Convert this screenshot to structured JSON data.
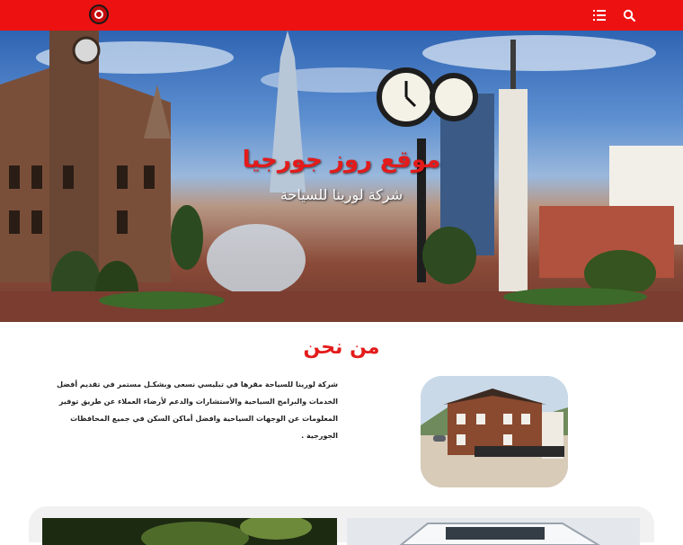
{
  "header": {
    "logo_icon": "rose-logo-icon",
    "menu_icon": "menu-list-icon",
    "search_icon": "search-icon",
    "bar_color": "#ee1111"
  },
  "hero": {
    "title": "موقع روز جورجيا",
    "subtitle": "شركة لورينا للسياحة",
    "title_color": "#e31b1b"
  },
  "about": {
    "heading": "من نحن",
    "body": "شركة لورينا للسياحة مقرها في تبليسي نسعى وبشكـل مستمر في تقديم أفضل الخدمات والبرامج السياحية والأستشارات والدعم لأرضاء العملاء عن طريق توفير المعلومات عن الوجهات السياحية وافضل أماكن السكن في جميع المحافظات الجورجية ."
  }
}
